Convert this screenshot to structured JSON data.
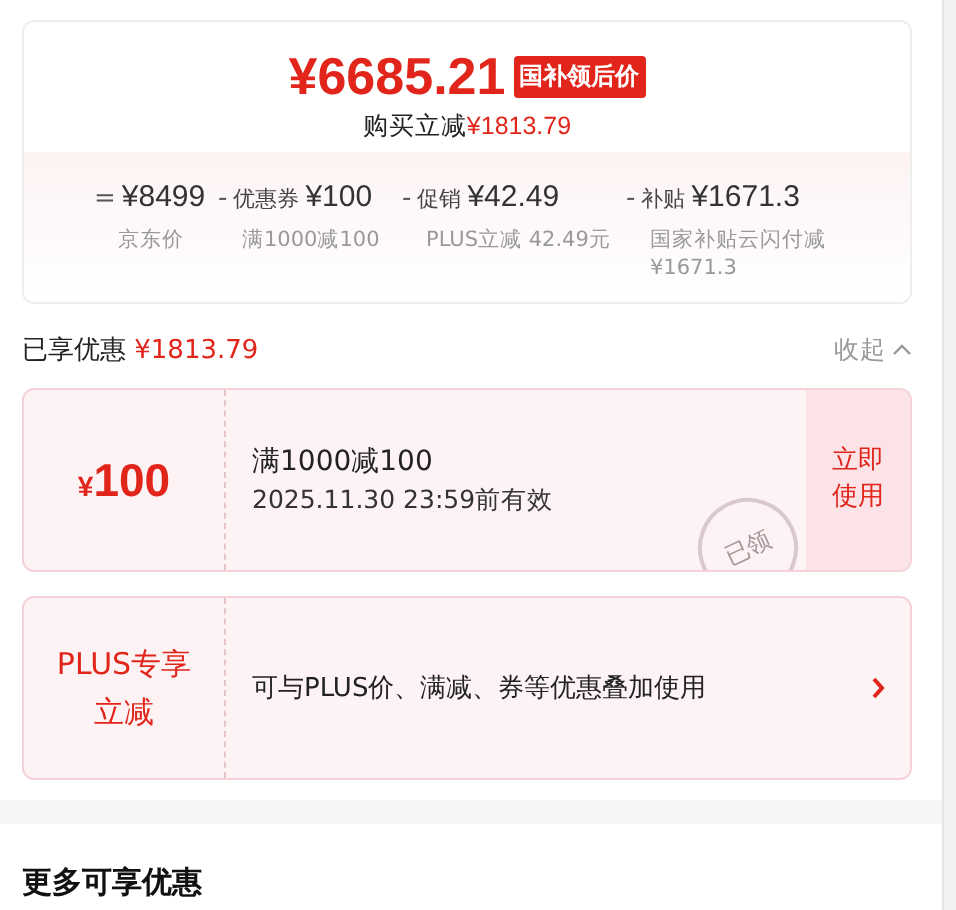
{
  "price": {
    "amount": "¥6685.21",
    "badge": "国补领后价",
    "saving_label": "购买立减",
    "saving_amount": "¥1813.79"
  },
  "breakdown": [
    {
      "op": "=",
      "amount": "¥8499",
      "note": "京东价"
    },
    {
      "op": "-",
      "label": "优惠券",
      "amount": "¥100",
      "note": "满1000减100"
    },
    {
      "op": "-",
      "label": "促销",
      "amount": "¥42.49",
      "note": "PLUS立减 42.49元"
    },
    {
      "op": "-",
      "label": "补贴",
      "amount": "¥1671.3",
      "note": "国家补贴云闪付减¥1671.3"
    }
  ],
  "summary": {
    "label": "已享优惠",
    "amount": "¥1813.79",
    "toggle": "收起",
    "expanded": true
  },
  "offers": [
    {
      "kind": "coupon",
      "currency": "¥",
      "value": "100",
      "title": "满1000减100",
      "validity": "2025.11.30 23:59前有效",
      "action": "立即使用",
      "stamp": "已领",
      "claimed": true
    },
    {
      "kind": "promo",
      "title": "PLUS专享立减",
      "description": "可与PLUS价、满减、券等优惠叠加使用"
    }
  ],
  "more": {
    "title": "更多可享优惠"
  }
}
